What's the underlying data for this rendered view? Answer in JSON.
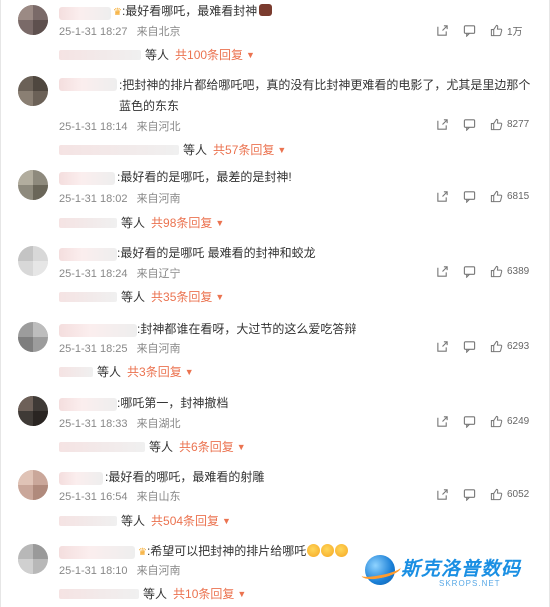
{
  "comments": [
    {
      "text": ":最好看哪吒，最难看封神",
      "time": "25-1-31 18:27",
      "location": "来自北京",
      "likes": "1万",
      "reply_suffix": "等人",
      "reply_count": "共100条回复",
      "crown": true,
      "emoji": "👹"
    },
    {
      "text": ":把封神的排片都给哪吒吧，真的没有比封神更难看的电影了，尤其是里边那个蓝色的东东",
      "time": "25-1-31 18:14",
      "location": "来自河北",
      "likes": "8277",
      "reply_suffix": "等人",
      "reply_count": "共57条回复"
    },
    {
      "text": ":最好看的是哪吒，最差的是封神!",
      "time": "25-1-31 18:02",
      "location": "来自河南",
      "likes": "6815",
      "reply_suffix": "等人",
      "reply_count": "共98条回复"
    },
    {
      "text": ":最好看的是哪吒 最难看的封神和蛟龙",
      "time": "25-1-31 18:24",
      "location": "来自辽宁",
      "likes": "6389",
      "reply_suffix": "等人",
      "reply_count": "共35条回复"
    },
    {
      "text": ":封神都谁在看呀，大过节的这么爱吃答辩",
      "time": "25-1-31 18:25",
      "location": "来自河南",
      "likes": "6293",
      "reply_suffix": "等人",
      "reply_count": "共3条回复"
    },
    {
      "text": ":哪吒第一，封神撤档",
      "time": "25-1-31 18:33",
      "location": "来自湖北",
      "likes": "6249",
      "reply_suffix": "等人",
      "reply_count": "共6条回复"
    },
    {
      "text": ":最好看的哪吒，最难看的射雕",
      "time": "25-1-31 16:54",
      "location": "来自山东",
      "likes": "6052",
      "reply_suffix": "等人",
      "reply_count": "共504条回复"
    },
    {
      "text": ":希望可以把封神的排片给哪吒",
      "time": "25-1-31 18:10",
      "location": "来自河南",
      "likes": "",
      "reply_suffix": "等人",
      "reply_count": "共10条回复",
      "crown": true
    }
  ],
  "watermark": {
    "brand": "斯克洛普数码",
    "site": "SKROPS.NET"
  },
  "colors": {
    "accent": "#eb7350",
    "meta": "#888888",
    "brand_blue": "#1a8fe3"
  },
  "icons": [
    "share-icon",
    "comment-icon",
    "like-icon",
    "crown-icon",
    "chevron-down-icon"
  ]
}
